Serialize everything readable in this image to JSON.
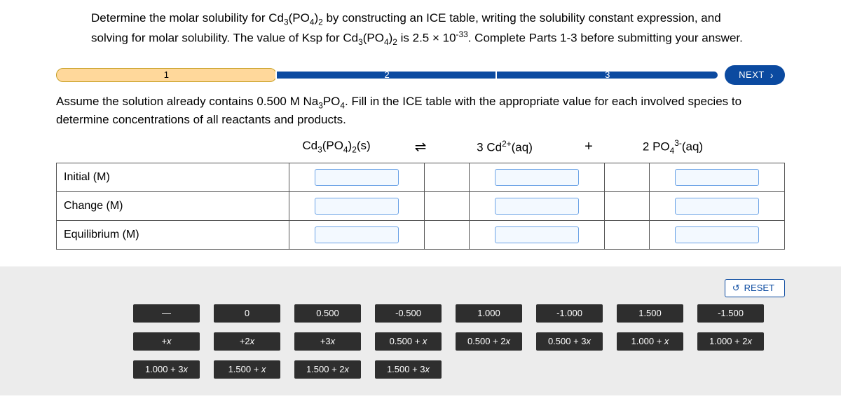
{
  "prompt_html": "Determine the molar solubility for Cd<sub>3</sub>(PO<sub>4</sub>)<sub>2</sub> by constructing an ICE table, writing the solubility constant expression, and solving for molar solubility. The value of Ksp for Cd<sub>3</sub>(PO<sub>4</sub>)<sub>2</sub> is 2.5 × 10<sup>-33</sup>. Complete Parts 1-3 before submitting your answer.",
  "steps": {
    "s1": "1",
    "s2": "2",
    "s3": "3",
    "next": "NEXT"
  },
  "instruction_html": "Assume the solution already contains 0.500 M Na<sub>3</sub>PO<sub>4</sub>. Fill in the ICE table with the appropriate value for each involved species to determine concentrations of all reactants and products.",
  "equation": {
    "lhs": "Cd<sub>3</sub>(PO<sub>4</sub>)<sub>2</sub>(s)",
    "eq": "⇌",
    "p1": "3 Cd<sup>2+</sup>(aq)",
    "plus": "+",
    "p2": "2 PO<sub>4</sub><sup>3-</sup>(aq)"
  },
  "rows": {
    "r1": "Initial (M)",
    "r2": "Change (M)",
    "r3": "Equilibrium (M)"
  },
  "reset": "RESET",
  "tiles": {
    "t0": "—",
    "t1": "0",
    "t2": "0.500",
    "t3": "-0.500",
    "t4": "1.000",
    "t5": "-1.000",
    "t6": "1.500",
    "t7": "-1.500",
    "t8": "+x",
    "t9": "+2x",
    "t10": "+3x",
    "t11": "0.500 + x",
    "t12": "0.500 + 2x",
    "t13": "0.500 + 3x",
    "t14": "1.000 + x",
    "t15": "1.000 + 2x",
    "t16": "1.000 + 3x",
    "t17": "1.500 + x",
    "t18": "1.500 + 2x",
    "t19": "1.500 + 3x"
  }
}
